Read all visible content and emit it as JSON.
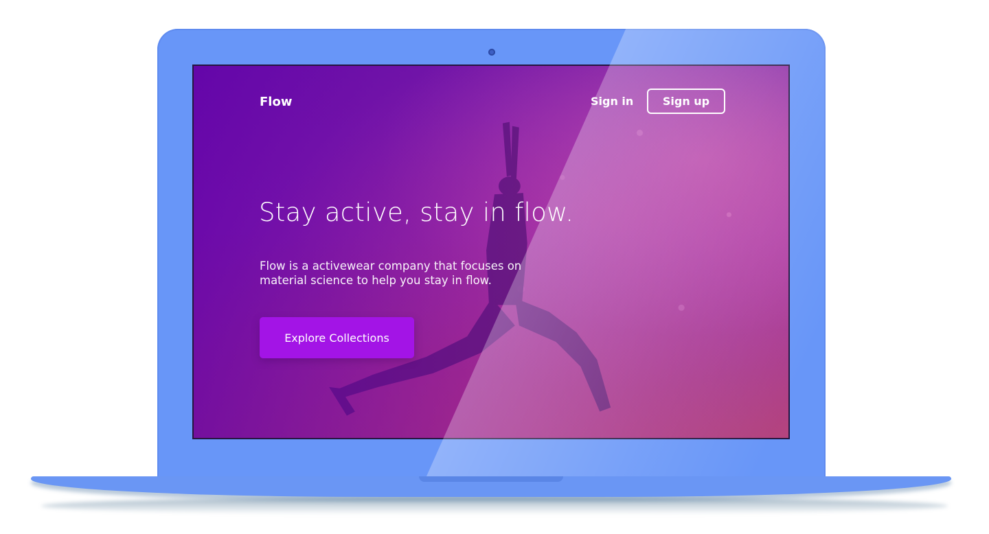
{
  "nav": {
    "brand": "Flow",
    "signin_label": "Sign in",
    "signup_label": "Sign up"
  },
  "hero": {
    "headline": "Stay active, stay in flow.",
    "subtext_line1": "Flow is a activewear company that focuses on",
    "subtext_line2": "material science to help you stay in flow.",
    "cta_label": "Explore Collections"
  },
  "colors": {
    "laptop_body": "#6896f8",
    "cta_background": "#a314e6",
    "overlay_tint": "#6200aa"
  },
  "icons": {
    "camera": "webcam-dot"
  }
}
